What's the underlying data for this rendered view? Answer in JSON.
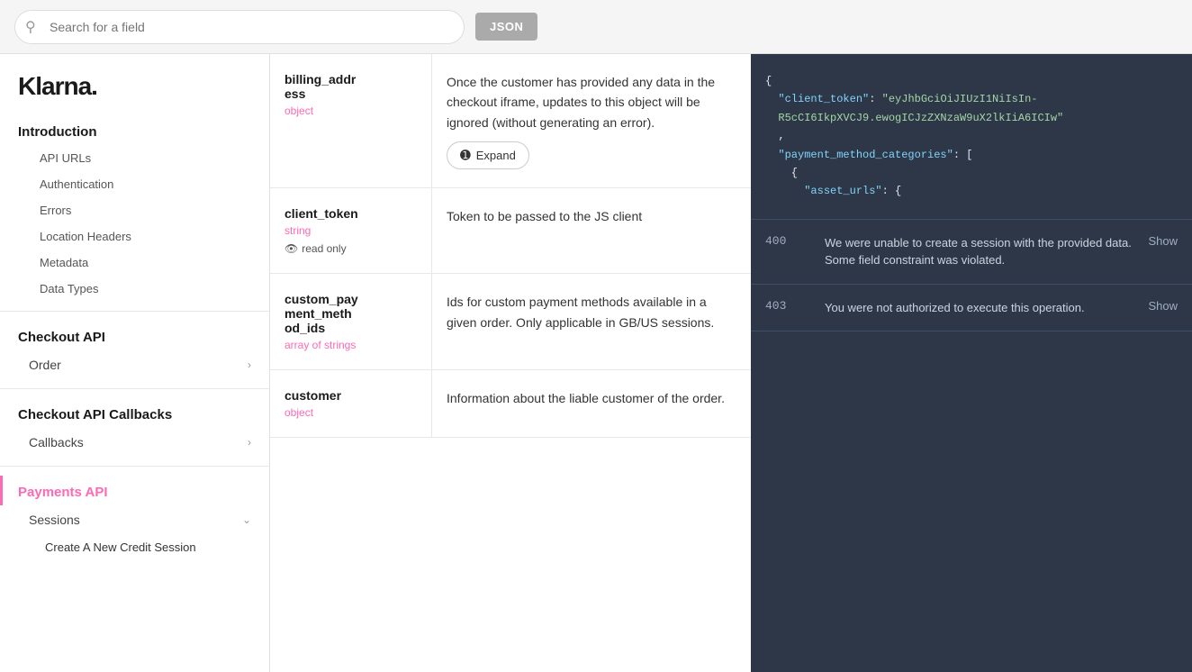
{
  "topbar": {
    "search_placeholder": "Search for a field",
    "json_button_label": "JSON"
  },
  "logo": "Klarna.",
  "sidebar": {
    "sections": [
      {
        "title": "Introduction",
        "items": [
          {
            "label": "API URLs",
            "sub": true
          },
          {
            "label": "Authentication",
            "sub": true
          },
          {
            "label": "Errors",
            "sub": true
          },
          {
            "label": "Location Headers",
            "sub": true
          },
          {
            "label": "Metadata",
            "sub": true
          },
          {
            "label": "Data Types",
            "sub": true
          }
        ]
      },
      {
        "title": "Checkout API",
        "items": [
          {
            "label": "Order",
            "hasChevron": true
          }
        ]
      },
      {
        "title": "Checkout API Callbacks",
        "items": [
          {
            "label": "Callbacks",
            "hasChevron": true
          }
        ]
      },
      {
        "title": "Payments API",
        "isActive": true,
        "items": [
          {
            "label": "Sessions",
            "hasChevron": true,
            "expanded": true
          },
          {
            "label": "Create A New Credit Session",
            "sub": true,
            "isSubActive": true
          }
        ]
      }
    ]
  },
  "fields": [
    {
      "name": "billing_address",
      "type": "object",
      "description": "Once the customer has provided any data in the checkout iframe, updates to this object will be ignored (without generating an error).",
      "hasExpand": true,
      "expand_label": "Expand",
      "readonly": false
    },
    {
      "name": "client_token",
      "type": "string",
      "description": "Token to be passed to the JS client",
      "hasExpand": false,
      "readonly": true,
      "readonly_label": "read only"
    },
    {
      "name": "custom_payment_method_ids",
      "type": "array of strings",
      "description": "Ids for custom payment methods available in a given order. Only applicable in GB/US sessions.",
      "hasExpand": false,
      "readonly": false
    },
    {
      "name": "customer",
      "type": "object",
      "description": "Information about the liable customer of the order.",
      "hasExpand": false,
      "readonly": false
    }
  ],
  "code": {
    "json_lines": [
      "{",
      "  \"client_token\": \"eyJhbGciOiJIUzI1NiIsIn-",
      "  R5cCI6IkpXVCJ9.ewogICJzZXNzaW9uX2lkIiA6ICIw\"",
      "  ,",
      "  \"payment_method_categories\": [",
      "    {",
      "      \"asset_urls\": {"
    ]
  },
  "responses": [
    {
      "code": "400",
      "description": "We were unable to create a session with the provided data. Some field constraint was violated.",
      "show_label": "Show"
    },
    {
      "code": "403",
      "description": "You were not authorized to execute this operation.",
      "show_label": "Show"
    }
  ]
}
